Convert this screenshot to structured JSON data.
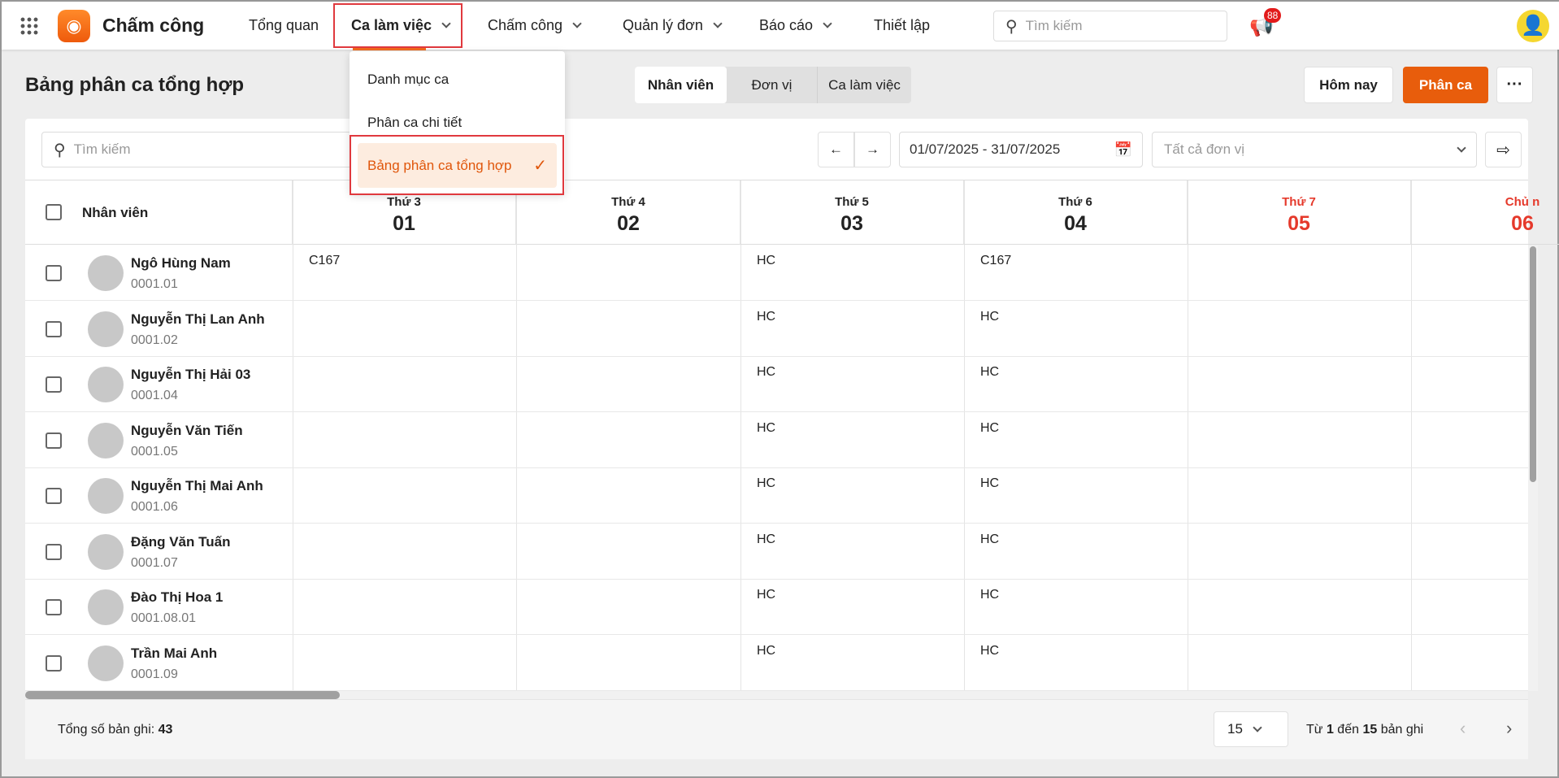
{
  "app": {
    "title": "Chấm công",
    "brand_color": "#f26b1d"
  },
  "nav": {
    "items": [
      {
        "label": "Tổng quan"
      },
      {
        "label": "Ca làm việc"
      },
      {
        "label": "Chấm công"
      },
      {
        "label": "Quản lý đơn"
      },
      {
        "label": "Báo cáo"
      },
      {
        "label": "Thiết lập"
      }
    ],
    "search_placeholder": "Tìm kiếm",
    "notification_count": "88"
  },
  "dropdown": {
    "items": [
      {
        "label": "Danh mục ca"
      },
      {
        "label": "Phân ca chi tiết"
      },
      {
        "label": "Bảng phân ca tổng hợp",
        "selected": true
      }
    ]
  },
  "page": {
    "title": "Bảng phân ca tổng hợp",
    "view_tabs": [
      "Nhân viên",
      "Đơn vị",
      "Ca làm việc"
    ],
    "today_button": "Hôm nay",
    "assign_button": "Phân ca"
  },
  "toolbar": {
    "search_placeholder": "Tìm kiếm",
    "date_range": "01/07/2025 - 31/07/2025",
    "unit_select": "Tất cả đơn vị"
  },
  "table": {
    "employee_header": "Nhân viên",
    "days": [
      {
        "dow": "Thứ 3",
        "day": "01"
      },
      {
        "dow": "Thứ 4",
        "day": "02"
      },
      {
        "dow": "Thứ 5",
        "day": "03"
      },
      {
        "dow": "Thứ 6",
        "day": "04"
      },
      {
        "dow": "Thứ 7",
        "day": "05",
        "weekend": true
      },
      {
        "dow": "Chủ n",
        "day": "06",
        "weekend": true
      }
    ],
    "rows": [
      {
        "name": "Ngô Hùng Nam",
        "code": "0001.01",
        "shifts": [
          "C167",
          "",
          "HC",
          "C167",
          "",
          ""
        ]
      },
      {
        "name": "Nguyễn Thị Lan Anh",
        "code": "0001.02",
        "shifts": [
          "",
          "",
          "HC",
          "HC",
          "",
          ""
        ]
      },
      {
        "name": "Nguyễn Thị Hải 03",
        "code": "0001.04",
        "shifts": [
          "",
          "",
          "HC",
          "HC",
          "",
          ""
        ]
      },
      {
        "name": "Nguyễn Văn Tiến",
        "code": "0001.05",
        "shifts": [
          "",
          "",
          "HC",
          "HC",
          "",
          ""
        ]
      },
      {
        "name": "Nguyễn Thị Mai Anh",
        "code": "0001.06",
        "shifts": [
          "",
          "",
          "HC",
          "HC",
          "",
          ""
        ]
      },
      {
        "name": "Đặng Văn Tuấn",
        "code": "0001.07",
        "shifts": [
          "",
          "",
          "HC",
          "HC",
          "",
          ""
        ]
      },
      {
        "name": "Đào Thị Hoa 1",
        "code": "0001.08.01",
        "shifts": [
          "",
          "",
          "HC",
          "HC",
          "",
          ""
        ]
      },
      {
        "name": "Trần Mai Anh",
        "code": "0001.09",
        "shifts": [
          "",
          "",
          "HC",
          "HC",
          "",
          ""
        ]
      }
    ]
  },
  "footer": {
    "total_label": "Tổng số bản ghi:",
    "total": "43",
    "page_size": "15",
    "range_prefix": "Từ",
    "range_from": "1",
    "range_mid": "đến",
    "range_to": "15",
    "range_suffix": "bản ghi"
  }
}
